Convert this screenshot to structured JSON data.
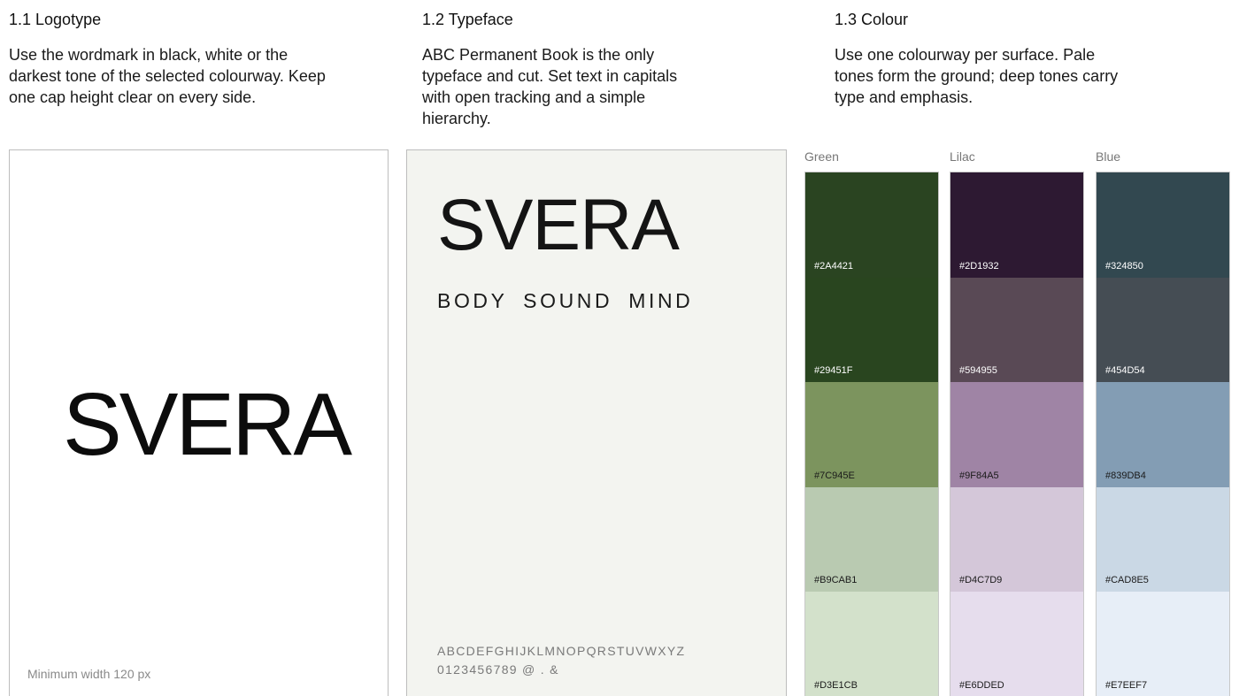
{
  "sections": {
    "logotype": {
      "title": "1.1 Logotype",
      "body": "Use the wordmark in black, white or the darkest tone of the selected colourway. Keep one cap height clear on every side.",
      "wordmark": "SVERA",
      "min_width_note": "Minimum width 120 px"
    },
    "typeface": {
      "title": "1.2 Typeface",
      "body": "ABC Permanent Book is the only typeface and cut. Set text in capitals with open tracking and a simple hierarchy.",
      "wordmark": "SVERA",
      "tagline": "BODY SOUND MIND",
      "alphabet": "ABCDEFGHIJKLMNOPQRSTUVWXYZ",
      "numerals": "0123456789 @ . &"
    },
    "colour": {
      "title": "1.3 Colour",
      "body": "Use one colourway per surface. Pale tones form the ground; deep tones carry type and emphasis."
    }
  },
  "colourways": [
    {
      "name": "Green",
      "swatches": [
        {
          "hex": "#2A4421",
          "label_color": "#ffffff"
        },
        {
          "hex": "#29451F",
          "label_color": "#ffffff"
        },
        {
          "hex": "#7C945E",
          "label_color": "#1a1a1a"
        },
        {
          "hex": "#B9CAB1",
          "label_color": "#1a1a1a"
        },
        {
          "hex": "#D3E1CB",
          "label_color": "#1a1a1a"
        }
      ]
    },
    {
      "name": "Lilac",
      "swatches": [
        {
          "hex": "#2D1932",
          "label_color": "#ffffff"
        },
        {
          "hex": "#594955",
          "label_color": "#ffffff"
        },
        {
          "hex": "#9F84A5",
          "label_color": "#1a1a1a"
        },
        {
          "hex": "#D4C7D9",
          "label_color": "#1a1a1a"
        },
        {
          "hex": "#E6DDED",
          "label_color": "#1a1a1a"
        }
      ]
    },
    {
      "name": "Blue",
      "swatches": [
        {
          "hex": "#324850",
          "label_color": "#ffffff"
        },
        {
          "hex": "#454D54",
          "label_color": "#ffffff"
        },
        {
          "hex": "#839DB4",
          "label_color": "#1a1a1a"
        },
        {
          "hex": "#CAD8E5",
          "label_color": "#1a1a1a"
        },
        {
          "hex": "#E7EEF7",
          "label_color": "#1a1a1a"
        }
      ]
    }
  ]
}
